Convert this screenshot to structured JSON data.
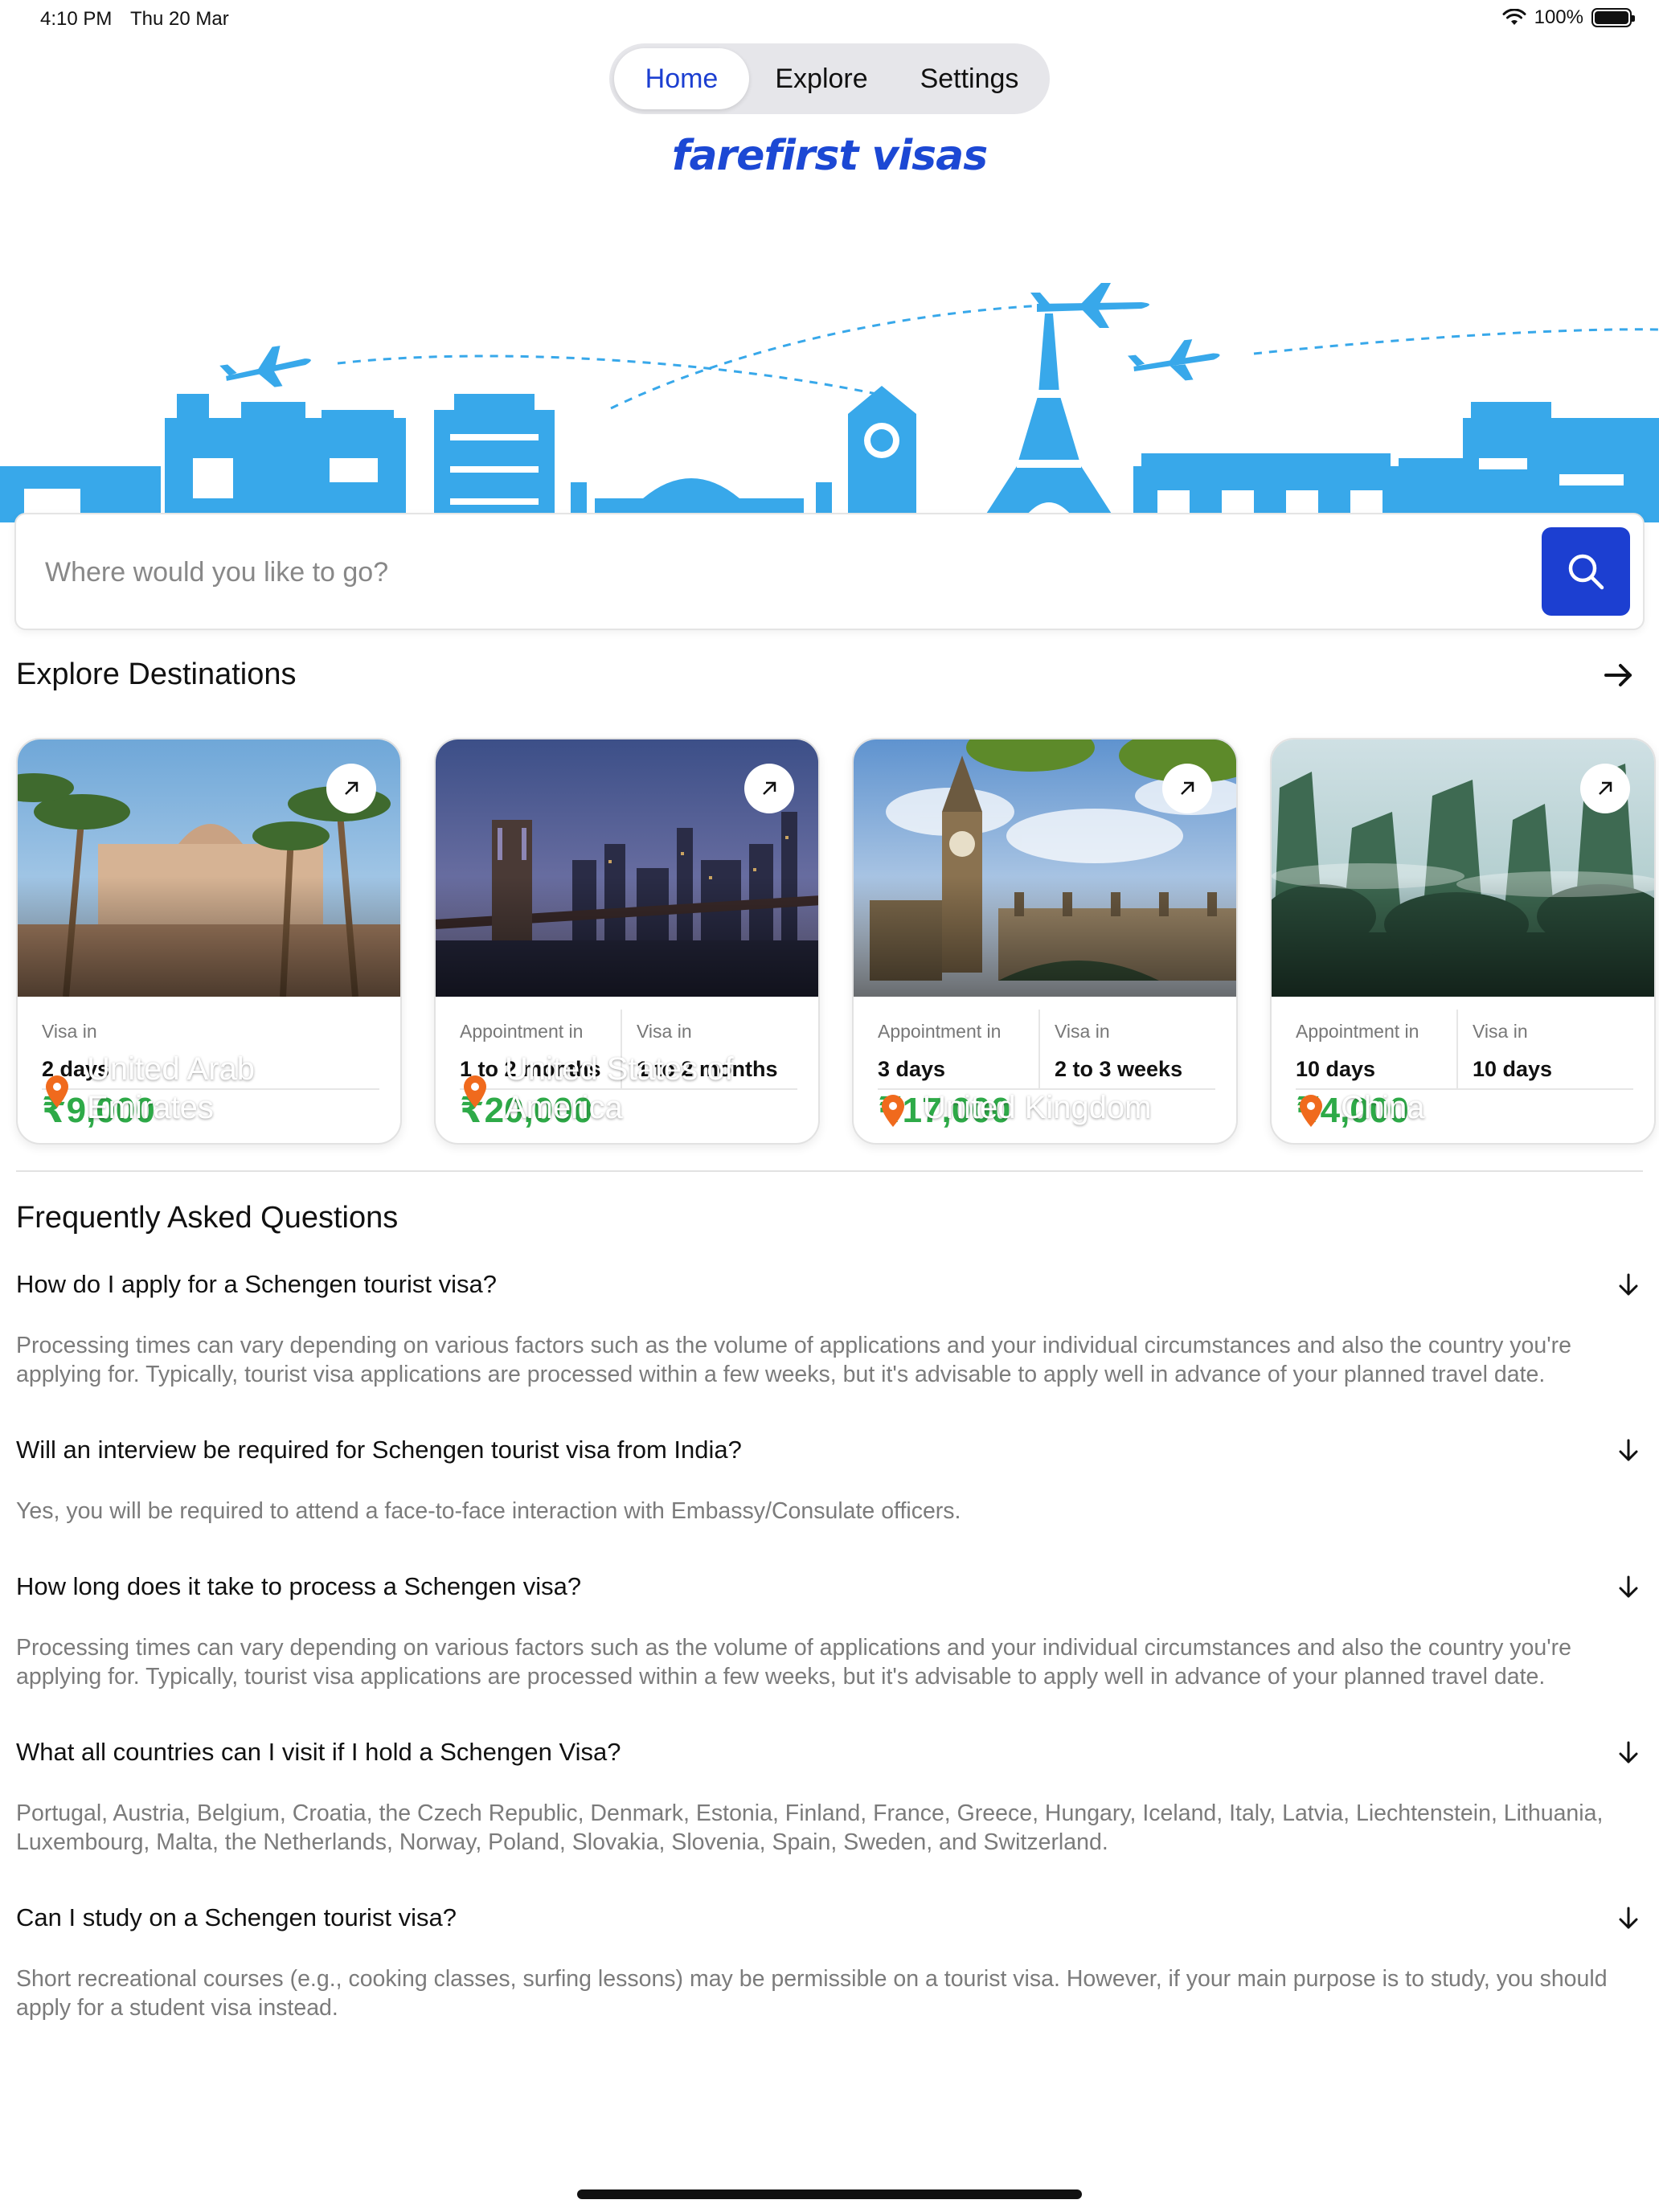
{
  "status_bar": {
    "time": "4:10 PM",
    "date": "Thu 20 Mar",
    "battery": "100%"
  },
  "nav": {
    "tabs": [
      {
        "label": "Home"
      },
      {
        "label": "Explore"
      },
      {
        "label": "Settings"
      }
    ],
    "active": "Home"
  },
  "brand": {
    "logo_text": "farefirst visas",
    "accent_color": "#1c3fd1",
    "skyline_color": "#38a8ea"
  },
  "search": {
    "placeholder": "Where would you like to go?",
    "value": ""
  },
  "explore": {
    "title": "Explore Destinations"
  },
  "destinations": [
    {
      "name": "United Arab Emirates",
      "info": [
        {
          "label": "Visa in",
          "value": "2 days"
        }
      ],
      "price": "₹9,000"
    },
    {
      "name": "United States of America",
      "info": [
        {
          "label": "Appointment in",
          "value": "1 to 2 months"
        },
        {
          "label": "Visa in",
          "value": "1 to 2 months"
        }
      ],
      "price": "₹20,000"
    },
    {
      "name": "United Kingdom",
      "info": [
        {
          "label": "Appointment in",
          "value": "3 days"
        },
        {
          "label": "Visa in",
          "value": "2 to 3 weeks"
        }
      ],
      "price": "₹17,000"
    },
    {
      "name": "China",
      "info": [
        {
          "label": "Appointment in",
          "value": "10 days"
        },
        {
          "label": "Visa in",
          "value": "10 days"
        }
      ],
      "price": "₹4,000"
    }
  ],
  "faq": {
    "title": "Frequently Asked Questions",
    "items": [
      {
        "question": "How do I apply for a Schengen tourist visa?",
        "answer": "Processing times can vary depending on various factors such as the volume of applications and your individual circumstances and also the country you're applying for. Typically, tourist visa applications are processed within a few weeks, but it's advisable to apply well in advance of your planned travel date."
      },
      {
        "question": "Will an interview be required for Schengen tourist visa from India?",
        "answer": "Yes, you will be required to attend a face-to-face interaction with Embassy/Consulate officers."
      },
      {
        "question": "How long does it take to process a Schengen visa?",
        "answer": "Processing times can vary depending on various factors such as the volume of applications and your individual circumstances and also the country you're applying for. Typically, tourist visa applications are processed within a few weeks, but it's advisable to apply well in advance of your planned travel date."
      },
      {
        "question": "What all countries can I visit if I hold a Schengen Visa?",
        "answer": "Portugal, Austria, Belgium, Croatia, the Czech Republic, Denmark, Estonia, Finland, France, Greece, Hungary, Iceland, Italy, Latvia, Liechtenstein, Lithuania, Luxembourg, Malta, the Netherlands, Norway, Poland, Slovakia, Slovenia, Spain, Sweden, and Switzerland."
      },
      {
        "question": "Can I study on a Schengen tourist visa?",
        "answer": "Short recreational courses (e.g., cooking classes, surfing lessons) may be permissible on a tourist visa. However, if your main purpose is to study, you should apply for a student visa instead."
      }
    ]
  }
}
